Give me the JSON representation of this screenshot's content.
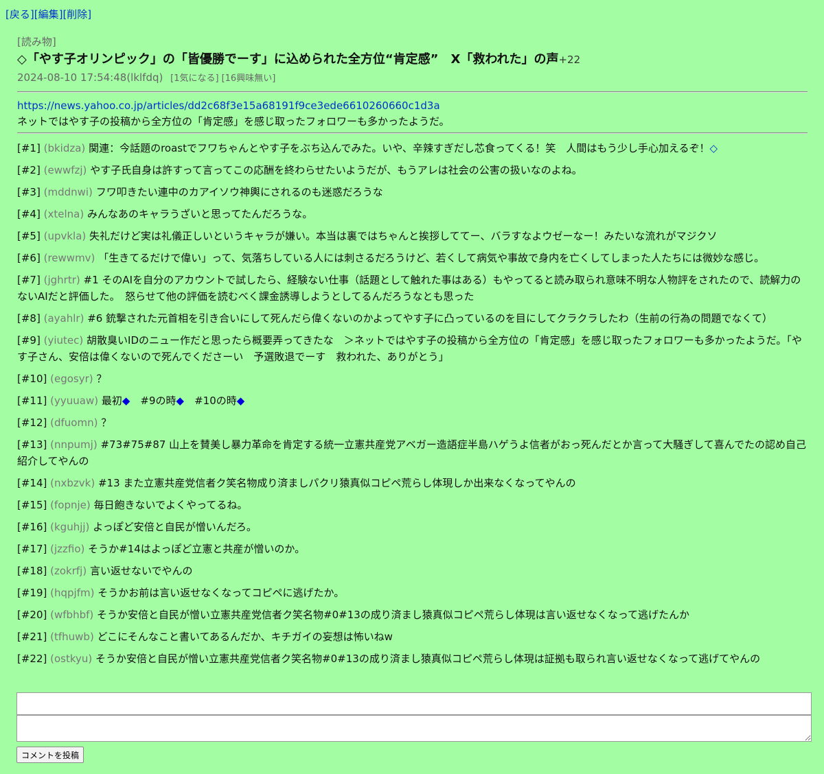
{
  "nav": {
    "back": "[戻る]",
    "edit": "[編集]",
    "delete": "[削除]"
  },
  "article": {
    "category": "[読み物]",
    "title": "◇「やす子オリンピック」の「皆優勝でーす」に込められた全方位“肯定感”　X「救われた」の声",
    "plus": "+22",
    "datetime": "2024-08-10 17:54:48",
    "author": "(lklfdq)",
    "interest": "[1気になる]",
    "no_interest": "[16興味無い]",
    "url": "https://news.yahoo.co.jp/articles/dd2c68f3e15a68191f9ce3ede6610260660c1d3a",
    "summary": "ネットではやす子の投稿から全方位の「肯定感」を感じ取ったフォロワーも多かったようだ。"
  },
  "comments": [
    {
      "num": "[#1]",
      "id": "(bkidza)",
      "text": "関連：今話題のroastでフワちゃんとやす子をぶち込んでみた。いや、辛辣すぎだし芯食ってくる！笑　人間はもう少し手心加えるぞ！",
      "tail": "◇"
    },
    {
      "num": "[#2]",
      "id": "(ewwfzj)",
      "text": "やす子氏自身は許すって言ってこの応酬を終わらせたいようだが、もうアレは社会の公害の扱いなのよね。"
    },
    {
      "num": "[#3]",
      "id": "(mddnwi)",
      "text": "フワ叩きたい連中のカアイソウ神輿にされるのも迷惑だろうな"
    },
    {
      "num": "[#4]",
      "id": "(xtelna)",
      "text": "みんなあのキャラうざいと思ってたんだろうな。"
    },
    {
      "num": "[#5]",
      "id": "(upvkla)",
      "text": "失礼だけど実は礼儀正しいというキャラが嫌い。本当は裏ではちゃんと挨拶しててー、バラすなよウゼーなー！みたいな流れがマジクソ"
    },
    {
      "num": "[#6]",
      "id": "(rewwmv)",
      "text": "「生きてるだけで偉い」って、気落ちしている人には刺さるだろうけど、若くして病気や事故で身内を亡くしてしまった人たちには微妙な感じ。"
    },
    {
      "num": "[#7]",
      "id": "(jghrtr)",
      "text": "#1 そのAIを自分のアカウントで試したら、経験ない仕事（話題として触れた事はある）もやってると読み取られ意味不明な人物評をされたので、読解力のないAIだと評価した。　怒らせて他の評価を読むべく課金誘導しようとしてるんだろうなとも思った"
    },
    {
      "num": "[#8]",
      "id": "(ayahlr)",
      "text": "#6 銃撃された元首相を引き合いにして死んだら偉くないのかよってやす子に凸っているのを目にしてクラクラしたわ（生前の行為の問題でなくて）"
    },
    {
      "num": "[#9]",
      "id": "(yiutec)",
      "text": "胡散臭いIDのニュー作だと思ったら概要弄ってきたな　＞ネットではやす子の投稿から全方位の「肯定感」を感じ取ったフォロワーも多かったようだ。「やす子さん、安倍は偉くないので死んでくださーい　予選敗退でーす　救われた、ありがとう」"
    },
    {
      "num": "[#10]",
      "id": "(egosyr)",
      "text": "？"
    },
    {
      "num": "[#11]",
      "id": "(yyuuaw)",
      "text": "",
      "parts": [
        "最初",
        "◆",
        "　#9の時",
        "◆",
        "　#10の時",
        "◆"
      ]
    },
    {
      "num": "[#12]",
      "id": "(dfuomn)",
      "text": "？"
    },
    {
      "num": "[#13]",
      "id": "(nnpumj)",
      "text": "#73#75#87 山上を賛美し暴力革命を肯定する統一立憲共産党アベガー造語症半島ハゲうよ信者がおっ死んだとか言って大騒ぎして喜んでたの認め自己紹介してやんの"
    },
    {
      "num": "[#14]",
      "id": "(nxbzvk)",
      "text": "#13 また立憲共産党信者ク笑名物成り済ましパクリ猿真似コピペ荒らし体現しか出来なくなってやんの"
    },
    {
      "num": "[#15]",
      "id": "(fopnje)",
      "text": "毎日飽きないでよくやってるね。"
    },
    {
      "num": "[#16]",
      "id": "(kguhjj)",
      "text": "よっぽど安倍と自民が憎いんだろ。"
    },
    {
      "num": "[#17]",
      "id": "(jzzfio)",
      "text": "そうか#14はよっぽど立憲と共産が憎いのか。"
    },
    {
      "num": "[#18]",
      "id": "(zokrfj)",
      "text": "言い返せないでやんの"
    },
    {
      "num": "[#19]",
      "id": "(hqpjfm)",
      "text": "そうかお前は言い返せなくなってコピペに逃げたか。"
    },
    {
      "num": "[#20]",
      "id": "(wfbhbf)",
      "text": "そうか安倍と自民が憎い立憲共産党信者ク笑名物#0#13の成り済まし猿真似コピペ荒らし体現は言い返せなくなって逃げたんか"
    },
    {
      "num": "[#21]",
      "id": "(tfhuwb)",
      "text": "どこにそんなこと書いてあるんだか、キチガイの妄想は怖いねw"
    },
    {
      "num": "[#22]",
      "id": "(ostkyu)",
      "text": "そうか安倍と自民が憎い立憲共産党信者ク笑名物#0#13の成り済まし猿真似コピペ荒らし体現は証拠も取られ言い返せなくなって逃げてやんの"
    }
  ],
  "form": {
    "name_value": "",
    "comment_value": "",
    "submit_label": "コメントを投稿"
  },
  "colors": {
    "background": "#a3fda3",
    "link": "#0033cc",
    "id_gray": "#777777",
    "diamond": "#0000dd"
  }
}
